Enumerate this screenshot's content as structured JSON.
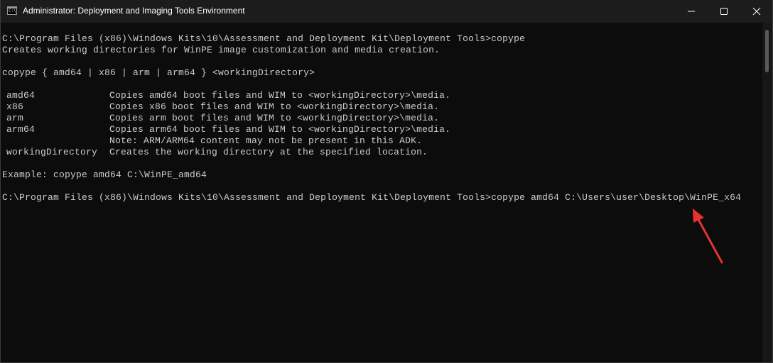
{
  "window": {
    "title": "Administrator: Deployment and Imaging Tools Environment",
    "icon": "cmd-icon",
    "controls": [
      "minimize-icon",
      "maximize-icon",
      "close-icon"
    ]
  },
  "console": {
    "prompt_line_1": "C:\\Program Files (x86)\\Windows Kits\\10\\Assessment and Deployment Kit\\Deployment Tools>copype",
    "description": "Creates working directories for WinPE image customization and media creation.",
    "usage": "copype { amd64 | x86 | arm | arm64 } <workingDirectory>",
    "options": [
      {
        "name": "amd64",
        "desc": "Copies amd64 boot files and WIM to <workingDirectory>\\media."
      },
      {
        "name": "x86",
        "desc": "Copies x86 boot files and WIM to <workingDirectory>\\media."
      },
      {
        "name": "arm",
        "desc": "Copies arm boot files and WIM to <workingDirectory>\\media."
      },
      {
        "name": "arm64",
        "desc": "Copies arm64 boot files and WIM to <workingDirectory>\\media."
      },
      {
        "name": "",
        "desc": "Note: ARM/ARM64 content may not be present in this ADK."
      },
      {
        "name": "workingDirectory",
        "desc": "Creates the working directory at the specified location."
      }
    ],
    "example": "Example: copype amd64 C:\\WinPE_amd64",
    "prompt_line_2": "C:\\Program Files (x86)\\Windows Kits\\10\\Assessment and Deployment Kit\\Deployment Tools>copype amd64 C:\\Users\\user\\Desktop\\WinPE_x64"
  },
  "colors": {
    "background": "#0c0c0c",
    "titlebar": "#1c1c1c",
    "text": "#cccccc",
    "annotation_arrow": "#e8332f"
  }
}
